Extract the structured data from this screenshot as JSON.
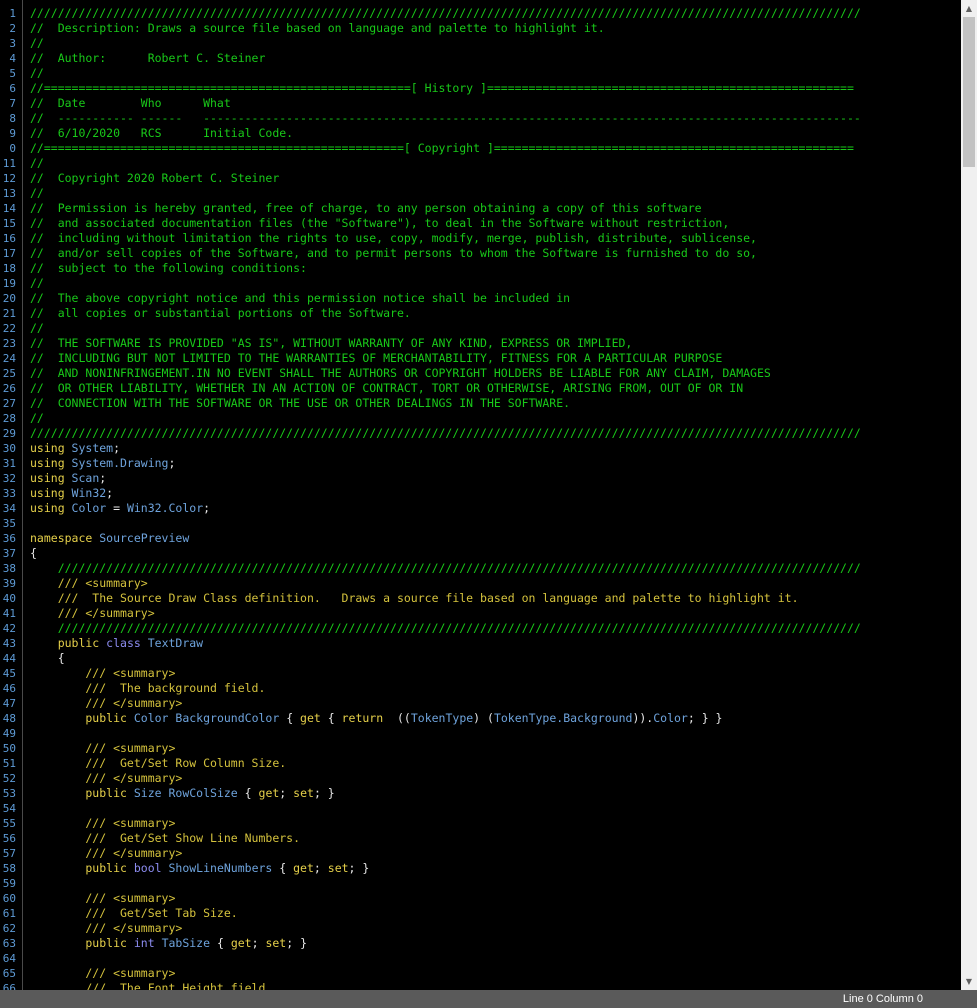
{
  "status": {
    "position": "Line 0 Column 0"
  },
  "code_lines": [
    {
      "n": "1",
      "segments": [
        {
          "t": "////////////////////////////////////////////////////////////////////////////////////////////////////////////////////////",
          "c": "c"
        }
      ]
    },
    {
      "n": "2",
      "segments": [
        {
          "t": "//  Description: Draws a source file based on language and palette to highlight it.",
          "c": "c"
        }
      ]
    },
    {
      "n": "3",
      "segments": [
        {
          "t": "//",
          "c": "c"
        }
      ]
    },
    {
      "n": "4",
      "segments": [
        {
          "t": "//  Author:      Robert C. Steiner",
          "c": "c"
        }
      ]
    },
    {
      "n": "5",
      "segments": [
        {
          "t": "//",
          "c": "c"
        }
      ]
    },
    {
      "n": "6",
      "segments": [
        {
          "t": "//=====================================================[ History ]=====================================================",
          "c": "c"
        }
      ]
    },
    {
      "n": "7",
      "segments": [
        {
          "t": "//  Date        Who      What",
          "c": "c"
        }
      ]
    },
    {
      "n": "8",
      "segments": [
        {
          "t": "//  ----------- ------   -----------------------------------------------------------------------------------------------",
          "c": "c"
        }
      ]
    },
    {
      "n": "9",
      "segments": [
        {
          "t": "//  6/10/2020   RCS      Initial Code.",
          "c": "c"
        }
      ]
    },
    {
      "n": "0",
      "segments": [
        {
          "t": "//====================================================[ Copyright ]====================================================",
          "c": "c"
        }
      ]
    },
    {
      "n": "11",
      "segments": [
        {
          "t": "//",
          "c": "c"
        }
      ]
    },
    {
      "n": "12",
      "segments": [
        {
          "t": "//  Copyright 2020 Robert C. Steiner",
          "c": "c"
        }
      ]
    },
    {
      "n": "13",
      "segments": [
        {
          "t": "//",
          "c": "c"
        }
      ]
    },
    {
      "n": "14",
      "segments": [
        {
          "t": "//  Permission is hereby granted, free of charge, to any person obtaining a copy of this software",
          "c": "c"
        }
      ]
    },
    {
      "n": "15",
      "segments": [
        {
          "t": "//  and associated documentation files (the \"Software\"), to deal in the Software without restriction,",
          "c": "c"
        }
      ]
    },
    {
      "n": "16",
      "segments": [
        {
          "t": "//  including without limitation the rights to use, copy, modify, merge, publish, distribute, sublicense,",
          "c": "c"
        }
      ]
    },
    {
      "n": "17",
      "segments": [
        {
          "t": "//  and/or sell copies of the Software, and to permit persons to whom the Software is furnished to do so,",
          "c": "c"
        }
      ]
    },
    {
      "n": "18",
      "segments": [
        {
          "t": "//  subject to the following conditions:",
          "c": "c"
        }
      ]
    },
    {
      "n": "19",
      "segments": [
        {
          "t": "//",
          "c": "c"
        }
      ]
    },
    {
      "n": "20",
      "segments": [
        {
          "t": "//  The above copyright notice and this permission notice shall be included in",
          "c": "c"
        }
      ]
    },
    {
      "n": "21",
      "segments": [
        {
          "t": "//  all copies or substantial portions of the Software.",
          "c": "c"
        }
      ]
    },
    {
      "n": "22",
      "segments": [
        {
          "t": "//",
          "c": "c"
        }
      ]
    },
    {
      "n": "23",
      "segments": [
        {
          "t": "//  THE SOFTWARE IS PROVIDED \"AS IS\", WITHOUT WARRANTY OF ANY KIND, EXPRESS OR IMPLIED,",
          "c": "c"
        }
      ]
    },
    {
      "n": "24",
      "segments": [
        {
          "t": "//  INCLUDING BUT NOT LIMITED TO THE WARRANTIES OF MERCHANTABILITY, FITNESS FOR A PARTICULAR PURPOSE",
          "c": "c"
        }
      ]
    },
    {
      "n": "25",
      "segments": [
        {
          "t": "//  AND NONINFRINGEMENT.IN NO EVENT SHALL THE AUTHORS OR COPYRIGHT HOLDERS BE LIABLE FOR ANY CLAIM, DAMAGES",
          "c": "c"
        }
      ]
    },
    {
      "n": "26",
      "segments": [
        {
          "t": "//  OR OTHER LIABILITY, WHETHER IN AN ACTION OF CONTRACT, TORT OR OTHERWISE, ARISING FROM, OUT OF OR IN",
          "c": "c"
        }
      ]
    },
    {
      "n": "27",
      "segments": [
        {
          "t": "//  CONNECTION WITH THE SOFTWARE OR THE USE OR OTHER DEALINGS IN THE SOFTWARE.",
          "c": "c"
        }
      ]
    },
    {
      "n": "28",
      "segments": [
        {
          "t": "//",
          "c": "c"
        }
      ]
    },
    {
      "n": "29",
      "segments": [
        {
          "t": "////////////////////////////////////////////////////////////////////////////////////////////////////////////////////////",
          "c": "c"
        }
      ]
    },
    {
      "n": "30",
      "segments": [
        {
          "t": "using",
          "c": "kw"
        },
        {
          "t": " System",
          "c": "id"
        },
        {
          "t": ";",
          "c": "p"
        }
      ]
    },
    {
      "n": "31",
      "segments": [
        {
          "t": "using",
          "c": "kw"
        },
        {
          "t": " System.Drawing",
          "c": "id"
        },
        {
          "t": ";",
          "c": "p"
        }
      ]
    },
    {
      "n": "32",
      "segments": [
        {
          "t": "using",
          "c": "kw"
        },
        {
          "t": " Scan",
          "c": "id"
        },
        {
          "t": ";",
          "c": "p"
        }
      ]
    },
    {
      "n": "33",
      "segments": [
        {
          "t": "using",
          "c": "kw"
        },
        {
          "t": " Win32",
          "c": "id"
        },
        {
          "t": ";",
          "c": "p"
        }
      ]
    },
    {
      "n": "34",
      "segments": [
        {
          "t": "using",
          "c": "kw"
        },
        {
          "t": " Color",
          "c": "id"
        },
        {
          "t": " = ",
          "c": "p"
        },
        {
          "t": "Win32.Color",
          "c": "id"
        },
        {
          "t": ";",
          "c": "p"
        }
      ]
    },
    {
      "n": "35",
      "segments": []
    },
    {
      "n": "36",
      "segments": [
        {
          "t": "namespace",
          "c": "kw"
        },
        {
          "t": " SourcePreview",
          "c": "id"
        }
      ]
    },
    {
      "n": "37",
      "segments": [
        {
          "t": "{",
          "c": "p"
        }
      ]
    },
    {
      "n": "38",
      "segments": [
        {
          "t": "    ////////////////////////////////////////////////////////////////////////////////////////////////////////////////////",
          "c": "c"
        }
      ]
    },
    {
      "n": "39",
      "segments": [
        {
          "t": "    /// <summary>",
          "c": "dc"
        }
      ]
    },
    {
      "n": "40",
      "segments": [
        {
          "t": "    ///  The Source Draw Class definition.   Draws a source file based on language and palette to highlight it.",
          "c": "dc"
        }
      ]
    },
    {
      "n": "41",
      "segments": [
        {
          "t": "    /// </summary>",
          "c": "dc"
        }
      ]
    },
    {
      "n": "42",
      "segments": [
        {
          "t": "    ////////////////////////////////////////////////////////////////////////////////////////////////////////////////////",
          "c": "c"
        }
      ]
    },
    {
      "n": "43",
      "segments": [
        {
          "t": "    public",
          "c": "kw"
        },
        {
          "t": " class",
          "c": "kb"
        },
        {
          "t": " TextDraw",
          "c": "id"
        }
      ]
    },
    {
      "n": "44",
      "segments": [
        {
          "t": "    {",
          "c": "p"
        }
      ]
    },
    {
      "n": "45",
      "segments": [
        {
          "t": "        /// <summary>",
          "c": "dc"
        }
      ]
    },
    {
      "n": "46",
      "segments": [
        {
          "t": "        ///  The background field.",
          "c": "dc"
        }
      ]
    },
    {
      "n": "47",
      "segments": [
        {
          "t": "        /// </summary>",
          "c": "dc"
        }
      ]
    },
    {
      "n": "48",
      "segments": [
        {
          "t": "        public",
          "c": "kw"
        },
        {
          "t": " Color",
          "c": "id"
        },
        {
          "t": " BackgroundColor",
          "c": "id"
        },
        {
          "t": " { ",
          "c": "p"
        },
        {
          "t": "get",
          "c": "kw"
        },
        {
          "t": " { ",
          "c": "p"
        },
        {
          "t": "return",
          "c": "kw"
        },
        {
          "t": "  ((",
          "c": "p"
        },
        {
          "t": "TokenType",
          "c": "id"
        },
        {
          "t": ") (",
          "c": "p"
        },
        {
          "t": "TokenType.Background",
          "c": "id"
        },
        {
          "t": ")).",
          "c": "p"
        },
        {
          "t": "Color",
          "c": "id"
        },
        {
          "t": "; } }",
          "c": "p"
        }
      ]
    },
    {
      "n": "49",
      "segments": []
    },
    {
      "n": "50",
      "segments": [
        {
          "t": "        /// <summary>",
          "c": "dc"
        }
      ]
    },
    {
      "n": "51",
      "segments": [
        {
          "t": "        ///  Get/Set Row Column Size.",
          "c": "dc"
        }
      ]
    },
    {
      "n": "52",
      "segments": [
        {
          "t": "        /// </summary>",
          "c": "dc"
        }
      ]
    },
    {
      "n": "53",
      "segments": [
        {
          "t": "        public",
          "c": "kw"
        },
        {
          "t": " Size",
          "c": "id"
        },
        {
          "t": " RowColSize",
          "c": "id"
        },
        {
          "t": " { ",
          "c": "p"
        },
        {
          "t": "get",
          "c": "kw"
        },
        {
          "t": "; ",
          "c": "p"
        },
        {
          "t": "set",
          "c": "kw"
        },
        {
          "t": "; }",
          "c": "p"
        }
      ]
    },
    {
      "n": "54",
      "segments": []
    },
    {
      "n": "55",
      "segments": [
        {
          "t": "        /// <summary>",
          "c": "dc"
        }
      ]
    },
    {
      "n": "56",
      "segments": [
        {
          "t": "        ///  Get/Set Show Line Numbers.",
          "c": "dc"
        }
      ]
    },
    {
      "n": "57",
      "segments": [
        {
          "t": "        /// </summary>",
          "c": "dc"
        }
      ]
    },
    {
      "n": "58",
      "segments": [
        {
          "t": "        public",
          "c": "kw"
        },
        {
          "t": " bool",
          "c": "kb"
        },
        {
          "t": " ShowLineNumbers",
          "c": "id"
        },
        {
          "t": " { ",
          "c": "p"
        },
        {
          "t": "get",
          "c": "kw"
        },
        {
          "t": "; ",
          "c": "p"
        },
        {
          "t": "set",
          "c": "kw"
        },
        {
          "t": "; }",
          "c": "p"
        }
      ]
    },
    {
      "n": "59",
      "segments": []
    },
    {
      "n": "60",
      "segments": [
        {
          "t": "        /// <summary>",
          "c": "dc"
        }
      ]
    },
    {
      "n": "61",
      "segments": [
        {
          "t": "        ///  Get/Set Tab Size.",
          "c": "dc"
        }
      ]
    },
    {
      "n": "62",
      "segments": [
        {
          "t": "        /// </summary>",
          "c": "dc"
        }
      ]
    },
    {
      "n": "63",
      "segments": [
        {
          "t": "        public",
          "c": "kw"
        },
        {
          "t": " int",
          "c": "kb"
        },
        {
          "t": " TabSize",
          "c": "id"
        },
        {
          "t": " { ",
          "c": "p"
        },
        {
          "t": "get",
          "c": "kw"
        },
        {
          "t": "; ",
          "c": "p"
        },
        {
          "t": "set",
          "c": "kw"
        },
        {
          "t": "; }",
          "c": "p"
        }
      ]
    },
    {
      "n": "64",
      "segments": []
    },
    {
      "n": "65",
      "segments": [
        {
          "t": "        /// <summary>",
          "c": "dc"
        }
      ]
    },
    {
      "n": "66",
      "segments": [
        {
          "t": "        ///  The Font Height field.",
          "c": "dc"
        }
      ]
    }
  ],
  "scrollbar": {
    "up_icon": "▲",
    "down_icon": "▼"
  }
}
